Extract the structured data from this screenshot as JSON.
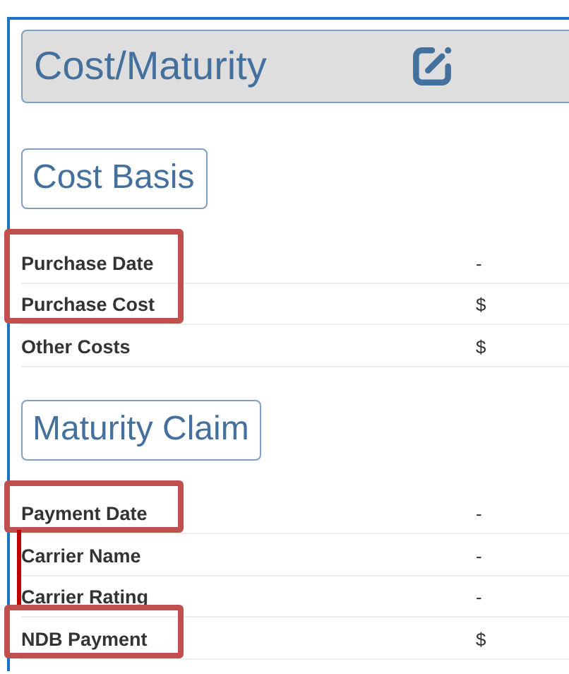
{
  "header": {
    "title": "Cost/Maturity"
  },
  "sections": [
    {
      "title": "Cost Basis",
      "rows": [
        {
          "label": "Purchase Date",
          "value": "-",
          "highlighted": true
        },
        {
          "label": "Purchase Cost",
          "value": "$",
          "highlighted": true
        },
        {
          "label": "Other Costs",
          "value": "$",
          "highlighted": false
        }
      ]
    },
    {
      "title": "Maturity Claim",
      "connector_line": true,
      "rows": [
        {
          "label": "Payment Date",
          "value": "-",
          "highlighted": true
        },
        {
          "label": "Carrier Name",
          "value": "-",
          "highlighted": false
        },
        {
          "label": "Carrier Rating",
          "value": "-",
          "highlighted": false
        },
        {
          "label": "NDB Payment",
          "value": "$",
          "highlighted": true
        }
      ]
    }
  ]
}
